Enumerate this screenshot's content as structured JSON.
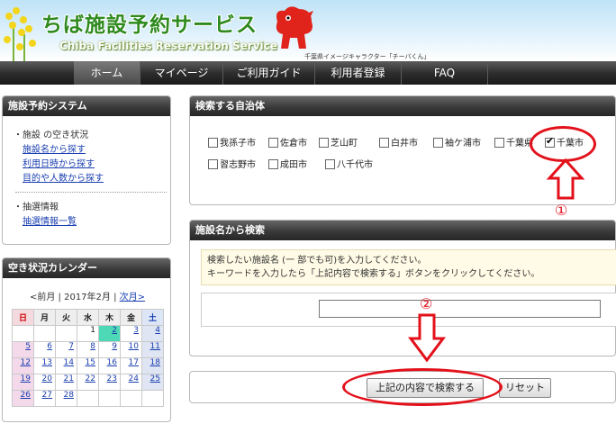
{
  "header": {
    "logo_ja": "ちば施設予約サービス",
    "logo_en": "Chiba Facilities Reservation Service",
    "mascot_caption": "千葉県イメージキャラクター「チーバくん」"
  },
  "nav": {
    "items": [
      {
        "label": "ホーム",
        "active": true
      },
      {
        "label": "マイページ",
        "active": false
      },
      {
        "label": "ご利用ガイド",
        "active": false
      },
      {
        "label": "利用者登録",
        "active": false
      },
      {
        "label": "FAQ",
        "active": false
      }
    ]
  },
  "sidebar": {
    "system": {
      "title": "施設予約システム",
      "group1_title": "施設 の空き状況",
      "links1": [
        "施設名から探す",
        "利用日時から探す",
        "目的や人数から探す"
      ],
      "group2_title": "抽選情報",
      "links2": [
        "抽選情報一覧"
      ]
    },
    "calendar": {
      "title": "空き状況カレンダー",
      "prev": "<前月",
      "sep": "|",
      "current": "2017年2月",
      "next": "次月>",
      "weekdays": [
        "日",
        "月",
        "火",
        "水",
        "木",
        "金",
        "土"
      ],
      "today": "2",
      "weeks": [
        [
          "",
          "",
          "",
          "1",
          "2",
          "3",
          "4"
        ],
        [
          "5",
          "6",
          "7",
          "8",
          "9",
          "10",
          "11"
        ],
        [
          "12",
          "13",
          "14",
          "15",
          "16",
          "17",
          "18"
        ],
        [
          "19",
          "20",
          "21",
          "22",
          "23",
          "24",
          "25"
        ],
        [
          "26",
          "27",
          "28",
          "",
          "",
          "",
          ""
        ]
      ],
      "linked_days": [
        "2",
        "3",
        "4",
        "5",
        "6",
        "7",
        "8",
        "9",
        "10",
        "11",
        "12",
        "13",
        "14",
        "15",
        "16",
        "17",
        "18",
        "19",
        "20",
        "21",
        "22",
        "23",
        "24",
        "25",
        "26",
        "27",
        "28"
      ]
    }
  },
  "municipality": {
    "title": "検索する自治体",
    "row1": [
      {
        "label": "我孫子市",
        "checked": false
      },
      {
        "label": "佐倉市",
        "checked": false
      },
      {
        "label": "芝山町",
        "checked": false
      },
      {
        "label": "白井市",
        "checked": false
      },
      {
        "label": "袖ケ浦市",
        "checked": false
      },
      {
        "label": "千葉県",
        "checked": false
      },
      {
        "label": "千葉市",
        "checked": true
      }
    ],
    "row2": [
      {
        "label": "習志野市",
        "checked": false
      },
      {
        "label": "成田市",
        "checked": false
      },
      {
        "label": "八千代市",
        "checked": false
      }
    ]
  },
  "facility_search": {
    "title": "施設名から検索",
    "line1": "検索したい施設名 (一 部でも可)を入力してください。",
    "line2": "キーワードを入力したら「上記内容で検索する」ボタンをクリックしてください。",
    "input_value": "",
    "search_button": "上記の内容で検索する",
    "reset_button": "リセット"
  },
  "annotations": {
    "marker1": "①",
    "marker2": "②",
    "color": "#e3101a"
  }
}
